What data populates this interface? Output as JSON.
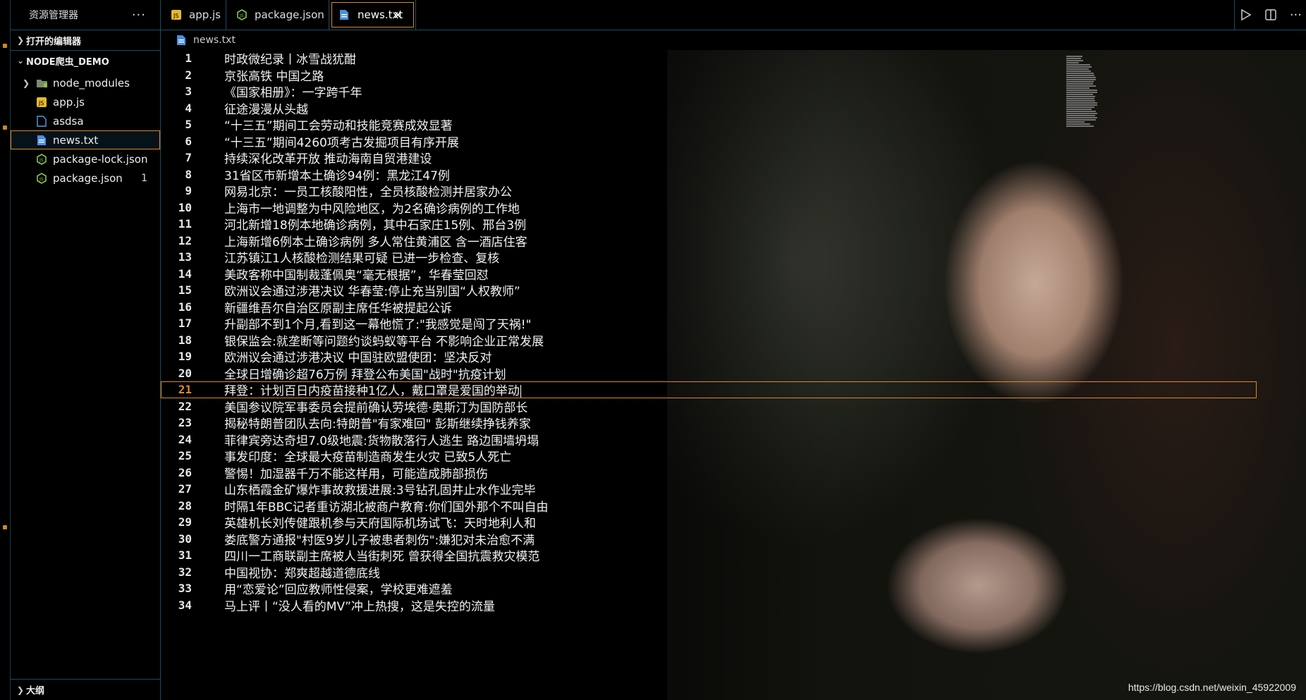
{
  "explorer": {
    "title": "资源管理器",
    "more": "···",
    "open_editors": "打开的编辑器",
    "project": "NODE爬虫_DEMO",
    "items": [
      {
        "label": "node_modules",
        "icon": "folder-icon",
        "badge": ""
      },
      {
        "label": "app.js",
        "icon": "js-file-icon",
        "badge": ""
      },
      {
        "label": "asdsa",
        "icon": "file-icon",
        "badge": ""
      },
      {
        "label": "news.txt",
        "icon": "text-file-icon",
        "badge": ""
      },
      {
        "label": "package-lock.json",
        "icon": "json-file-icon",
        "badge": ""
      },
      {
        "label": "package.json",
        "icon": "json-file-icon",
        "badge": "1"
      }
    ],
    "outline": "大纲"
  },
  "tabs": [
    {
      "label": "app.js",
      "icon": "js-file-icon"
    },
    {
      "label": "package.json",
      "icon": "json-file-icon"
    },
    {
      "label": "news.txt",
      "icon": "text-file-icon",
      "close": "✕"
    }
  ],
  "breadcrumb": "news.txt",
  "editor": {
    "current_line": 21,
    "lines": [
      "时政微纪录丨冰雪战犹酣",
      "京张高铁 中国之路",
      "《国家相册》：一字跨千年",
      "征途漫漫从头越",
      "“十三五”期间工会劳动和技能竞赛成效显著",
      "“十三五”期间4260项考古发掘项目有序开展",
      "持续深化改革开放 推动海南自贸港建设",
      "31省区市新增本土确诊94例：黑龙江47例",
      "网易北京：一员工核酸阳性，全员核酸检测并居家办公",
      "上海市一地调整为中风险地区，为2名确诊病例的工作地",
      "河北新增18例本地确诊病例，其中石家庄15例、邢台3例",
      "上海新增6例本土确诊病例 多人常住黄浦区 含一酒店住客",
      "江苏镇江1人核酸检测结果可疑 已进一步检查、复核",
      "美政客称中国制裁蓬佩奥“毫无根据”，华春莹回怼",
      "欧洲议会通过涉港决议 华春莹:停止充当别国“人权教师”",
      "新疆维吾尔自治区原副主席任华被提起公诉",
      "升副部不到1个月,看到这一幕他慌了:\"我感觉是闯了天祸!\"",
      "银保监会:就垄断等问题约谈蚂蚁等平台 不影响企业正常发展",
      "欧洲议会通过涉港决议 中国驻欧盟使团：坚决反对",
      "全球日增确诊超76万例 拜登公布美国\"战时\"抗疫计划",
      "拜登：计划百日内疫苗接种1亿人，戴口罩是爱国的举动",
      "美国参议院军事委员会提前确认劳埃德·奥斯汀为国防部长",
      "揭秘特朗普团队去向:特朗普\"有家难回\" 彭斯继续挣钱养家",
      "菲律宾旁达奇坦7.0级地震:货物散落行人逃生 路边围墙坍塌",
      "事发印度：全球最大疫苗制造商发生火灾 已致5人死亡",
      "警惕！加湿器千万不能这样用，可能造成肺部损伤",
      "山东栖霞金矿爆炸事故救援进展:3号钻孔固井止水作业完毕",
      "时隔1年BBC记者重访湖北被商户教育:你们国外那个不叫自由",
      "英雄机长刘传健跟机参与天府国际机场试飞：天时地利人和",
      "娄底警方通报\"村医9岁儿子被患者刺伤\":嫌犯对未治愈不满",
      "四川一工商联副主席被人当街刺死 曾获得全国抗震救灾模范",
      "中国视协：郑爽超越道德底线",
      "用“恋爱论”回应教师性侵案，学校更难遮羞",
      "马上评丨“没人看的MV”冲上热搜，这是失控的流量"
    ]
  },
  "watermark": "https://blog.csdn.net/weixin_45922009",
  "colors": {
    "accent": "#d98a24",
    "border": "#1e4c63",
    "js": "#e5b92b",
    "json": "#8bc34a",
    "txt": "#4a8fe0"
  }
}
